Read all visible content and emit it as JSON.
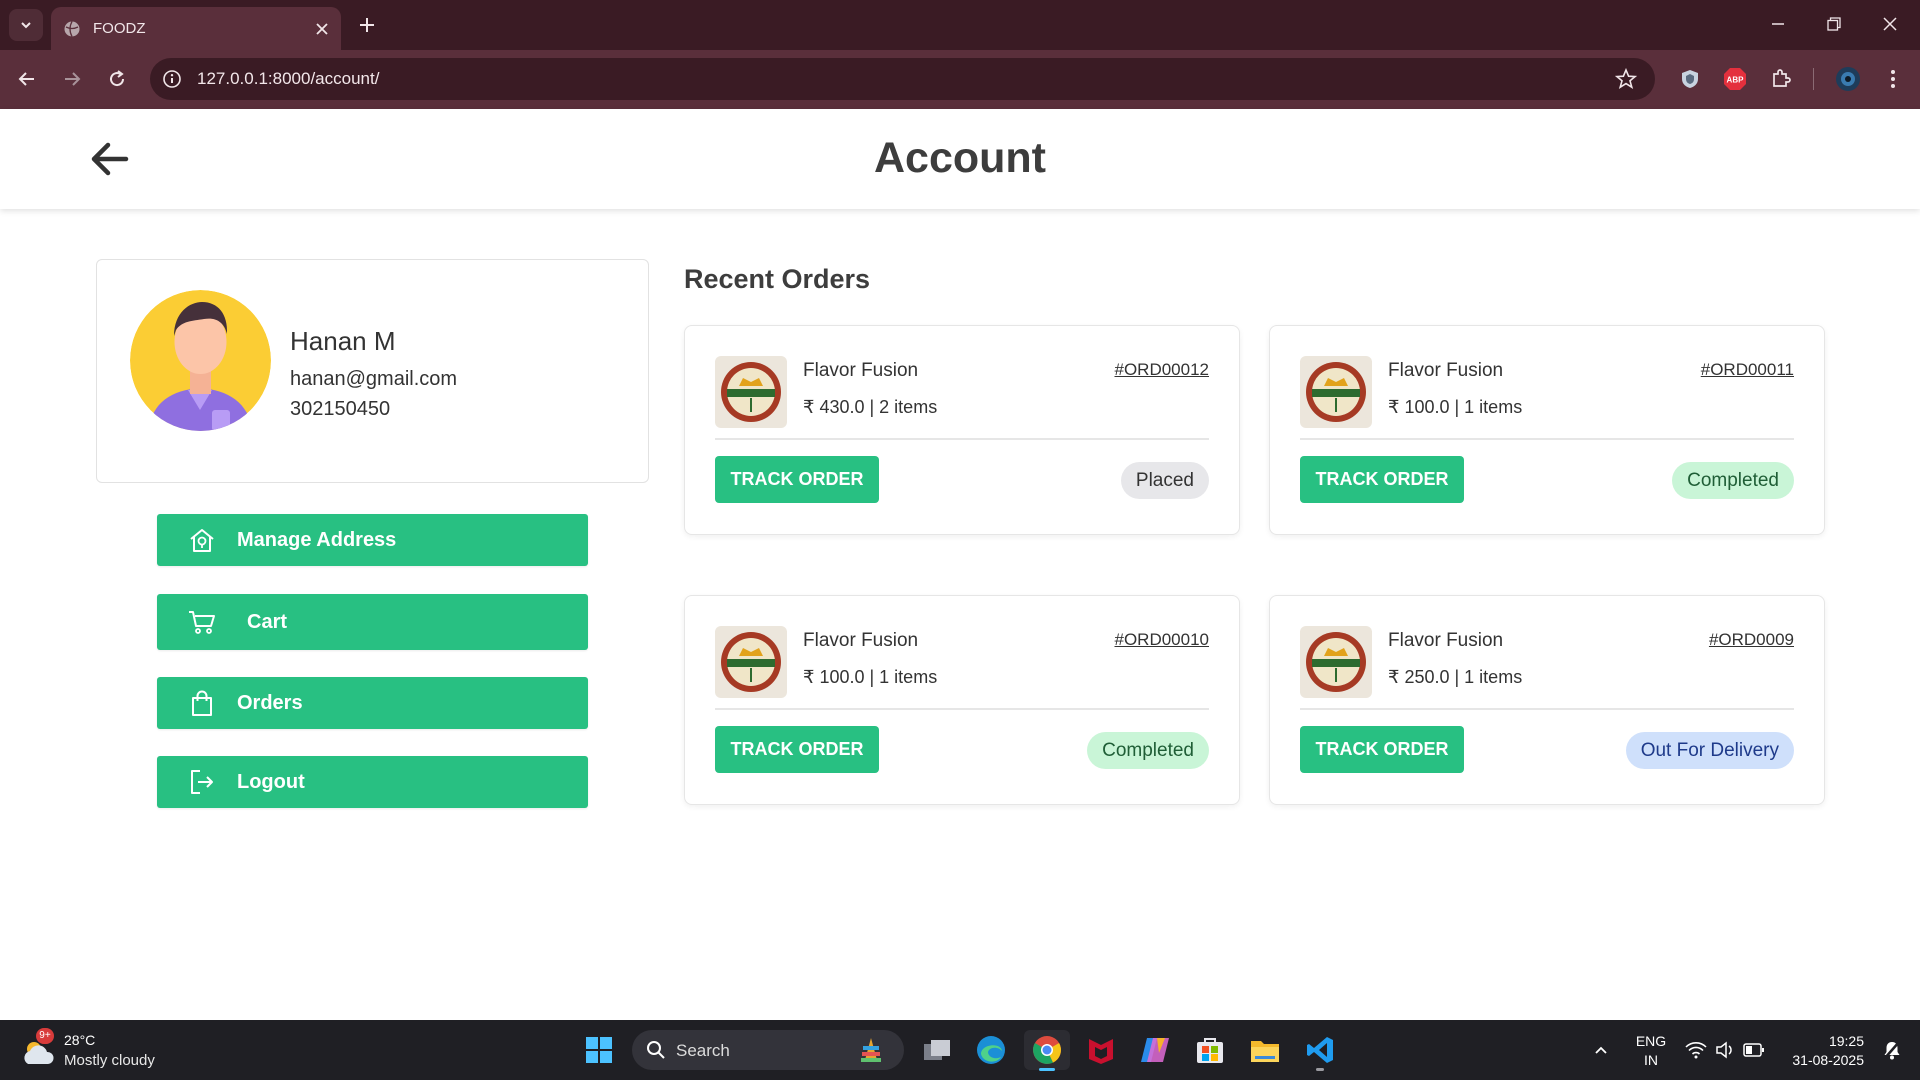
{
  "browser": {
    "tab_title": "FOODZ",
    "url": "127.0.0.1:8000/account/"
  },
  "page": {
    "title": "Account"
  },
  "profile": {
    "name": "Hanan M",
    "email": "hanan@gmail.com",
    "phone": "302150450"
  },
  "menu": {
    "items": [
      {
        "label": "Manage Address",
        "icon": "home-location-icon"
      },
      {
        "label": "Cart",
        "icon": "cart-icon"
      },
      {
        "label": "Orders",
        "icon": "shopping-bag-icon"
      },
      {
        "label": "Logout",
        "icon": "logout-icon"
      }
    ]
  },
  "orders": {
    "title": "Recent Orders",
    "track_label": "TRACK ORDER",
    "list": [
      {
        "restaurant": "Flavor Fusion",
        "id": "#ORD00012",
        "meta": "₹ 430.0 | 2 items",
        "status": "Placed",
        "status_bg": "#e7e7ea",
        "status_fg": "#333333"
      },
      {
        "restaurant": "Flavor Fusion",
        "id": "#ORD00011",
        "meta": "₹ 100.0 | 1 items",
        "status": "Completed",
        "status_bg": "#c9f5d7",
        "status_fg": "#1f5e36"
      },
      {
        "restaurant": "Flavor Fusion",
        "id": "#ORD00010",
        "meta": "₹ 100.0 | 1 items",
        "status": "Completed",
        "status_bg": "#c9f5d7",
        "status_fg": "#1f5e36"
      },
      {
        "restaurant": "Flavor Fusion",
        "id": "#ORD0009",
        "meta": "₹ 250.0 | 1 items",
        "status": "Out For Delivery",
        "status_bg": "#cfe0fb",
        "status_fg": "#1e3a8a"
      }
    ]
  },
  "colors": {
    "accent": "#28c082",
    "browser_frame": "#3a1b24",
    "browser_toolbar": "#5a2f3b"
  },
  "taskbar": {
    "weather_temp": "28°C",
    "weather_cond": "Mostly cloudy",
    "weather_badge": "9+",
    "search_label": "Search",
    "lang_top": "ENG",
    "lang_bottom": "IN",
    "time": "19:25",
    "date": "31-08-2025"
  }
}
